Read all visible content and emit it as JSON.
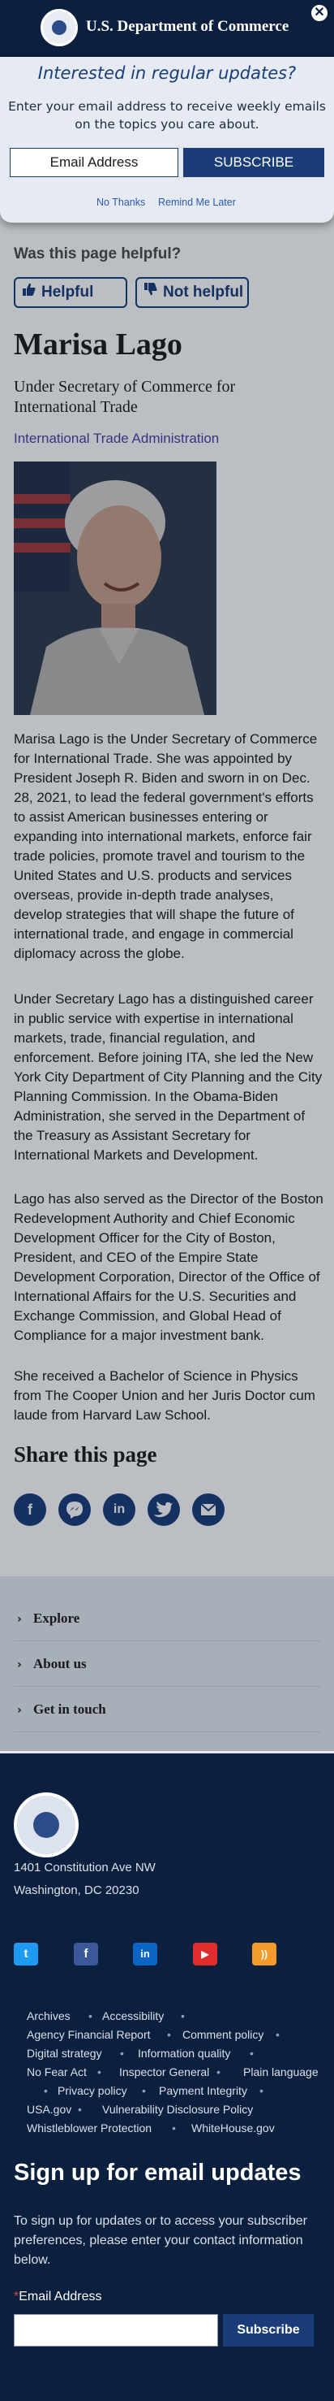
{
  "header": {
    "site_title": "U.S. Department of Commerce",
    "close_label": "✕"
  },
  "modal": {
    "title": "Interested in regular updates?",
    "description": "Enter your email address to receive weekly emails on the topics you care about.",
    "email_placeholder": "Email Address",
    "subscribe_label": "SUBSCRIBE",
    "no_thanks_label": "No Thanks",
    "remind_label": "Remind Me Later"
  },
  "feedback": {
    "question": "Was this page helpful?",
    "yes_label": "Helpful",
    "no_label": "Not helpful"
  },
  "profile": {
    "name": "Marisa Lago",
    "title": "Under Secretary of Commerce for International Trade",
    "agency": "International Trade Administration",
    "bio": [
      "Marisa Lago is the Under Secretary of Commerce for International Trade. She was appointed by President Joseph R. Biden and sworn in on Dec. 28, 2021, to lead the federal government's efforts to assist American businesses entering or expanding into international markets, enforce fair trade policies, promote travel and tourism to the United States and U.S. products and services overseas, provide in-depth trade analyses, develop strategies that will shape the future of international trade, and engage in commercial diplomacy across the globe.",
      "Under Secretary Lago has a distinguished career in public service with expertise in international markets, trade, financial regulation, and enforcement. Before joining ITA, she led the New York City Department of City Planning and the City Planning Commission. In the Obama-Biden Administration, she served in the Department of the Treasury as Assistant Secretary for International Markets and Development.",
      "Lago has also served as the Director of the Boston Redevelopment Authority and Chief Economic Development Officer for the City of Boston, President, and CEO of the Empire State Development Corporation, Director of the Office of International Affairs for the U.S. Securities and Exchange Commission, and Global Head of Compliance for a major investment bank.",
      "She received a Bachelor of Science in Physics from The Cooper Union and her Juris Doctor cum laude from Harvard Law School."
    ]
  },
  "share": {
    "title": "Share this page",
    "icons": [
      "facebook-icon",
      "messenger-icon",
      "linkedin-icon",
      "twitter-icon",
      "email-icon"
    ]
  },
  "accordion": {
    "items": [
      "Explore",
      "About us",
      "Get in touch"
    ]
  },
  "footer": {
    "address_line1": "1401 Constitution Ave NW",
    "address_line2": "Washington, DC 20230",
    "social": [
      "twitter-icon",
      "facebook-icon",
      "linkedin-icon",
      "youtube-icon",
      "rss-icon"
    ],
    "links": [
      "Archives",
      "Accessibility",
      "Agency Financial Report",
      "Comment policy",
      "Digital strategy",
      "Information quality",
      "No Fear Act",
      "Inspector General",
      "Plain language",
      "Privacy policy",
      "Payment Integrity",
      "USA.gov",
      "Vulnerability Disclosure Policy",
      "Whistleblower Protection",
      "WhiteHouse.gov"
    ],
    "signup_title": "Sign up for email updates",
    "signup_description": "To sign up for updates or to access your subscriber preferences, please enter your contact information below.",
    "email_label": "Email Address",
    "required_mark": "*",
    "subscribe_label": "Subscribe"
  },
  "colors": {
    "navy": "#0b1f3f",
    "brand_blue": "#1a3c78",
    "link_purple": "#4a3fa0"
  }
}
